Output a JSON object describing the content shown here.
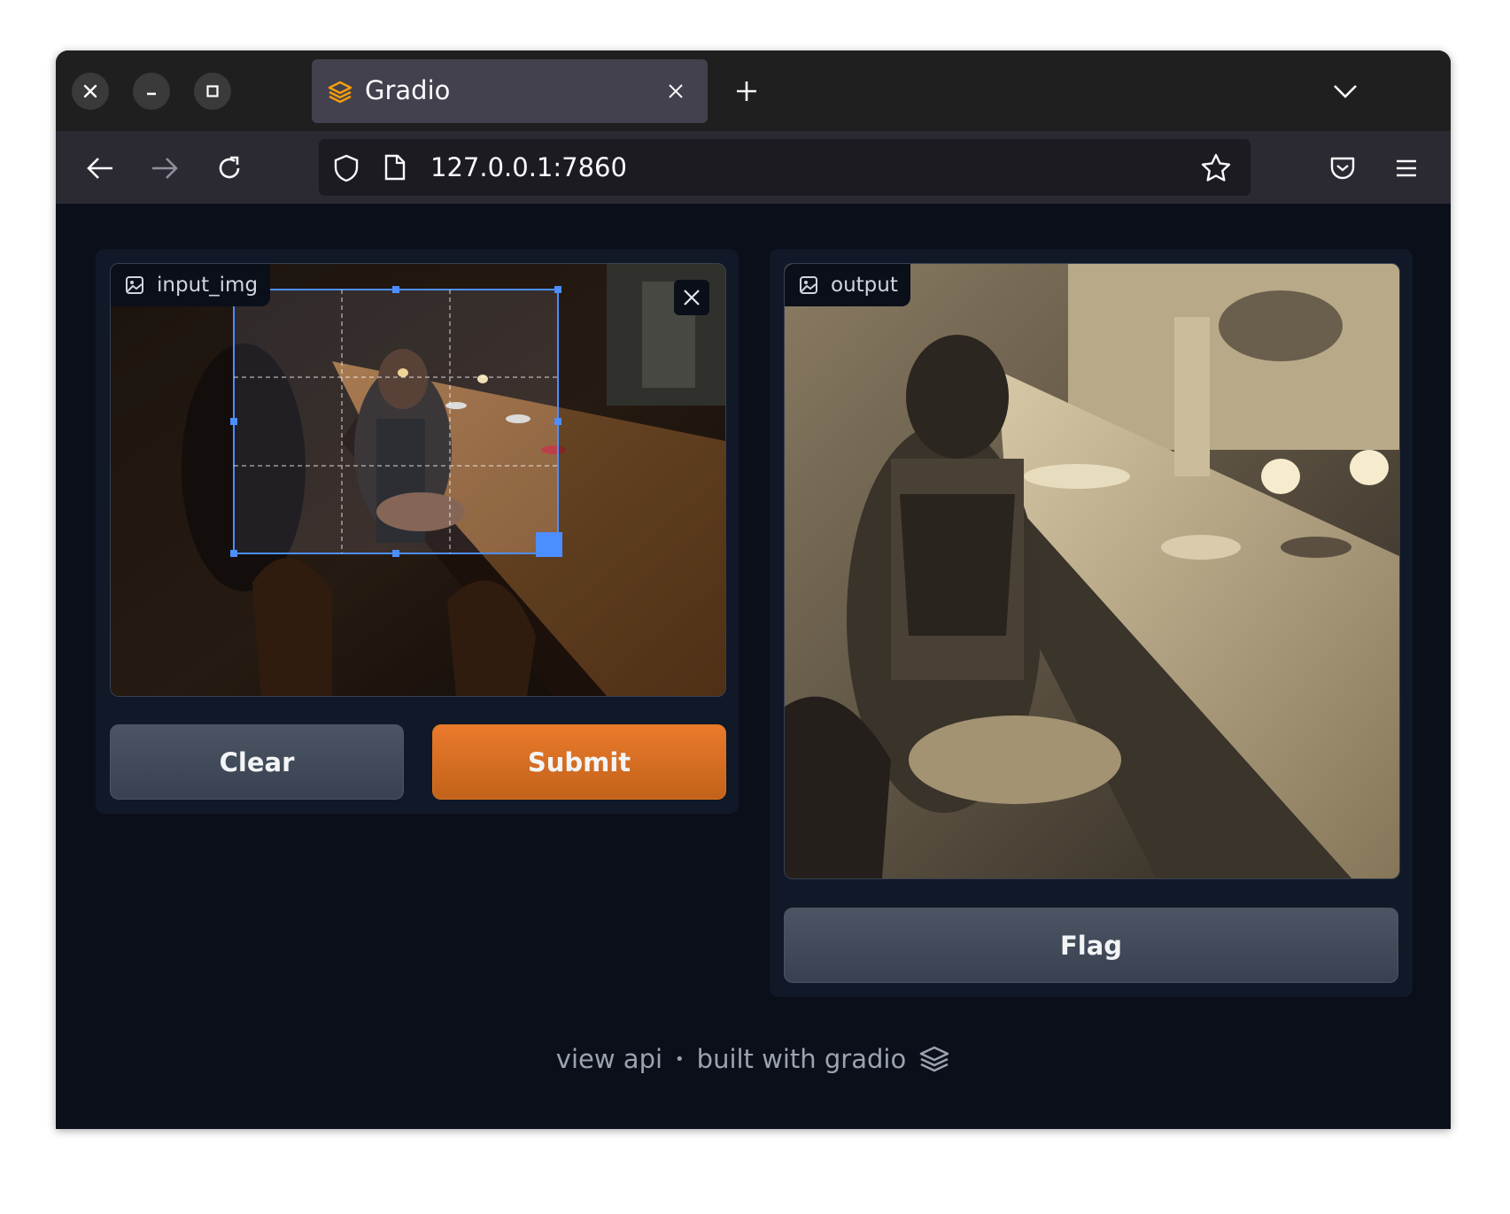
{
  "browser": {
    "tab_title": "Gradio",
    "url": "127.0.0.1:7860"
  },
  "input_panel": {
    "label": "input_img",
    "clear_label": "Clear",
    "submit_label": "Submit"
  },
  "output_panel": {
    "label": "output",
    "flag_label": "Flag"
  },
  "footer": {
    "view_api": "view api",
    "separator": "•",
    "built_with": "built with gradio"
  },
  "colors": {
    "page_bg": "#0b0f19",
    "panel_bg": "#111827",
    "primary": "#ea7a2c",
    "secondary": "#4b5563",
    "crop_accent": "#4c8eff"
  },
  "icons": [
    "close-icon",
    "minimize-icon",
    "maximize-icon",
    "gradio-logo-icon",
    "new-tab-icon",
    "list-tabs-icon",
    "back-icon",
    "forward-icon",
    "reload-icon",
    "shield-icon",
    "page-icon",
    "bookmark-star-icon",
    "pocket-icon",
    "menu-icon",
    "image-icon",
    "remove-image-icon"
  ]
}
